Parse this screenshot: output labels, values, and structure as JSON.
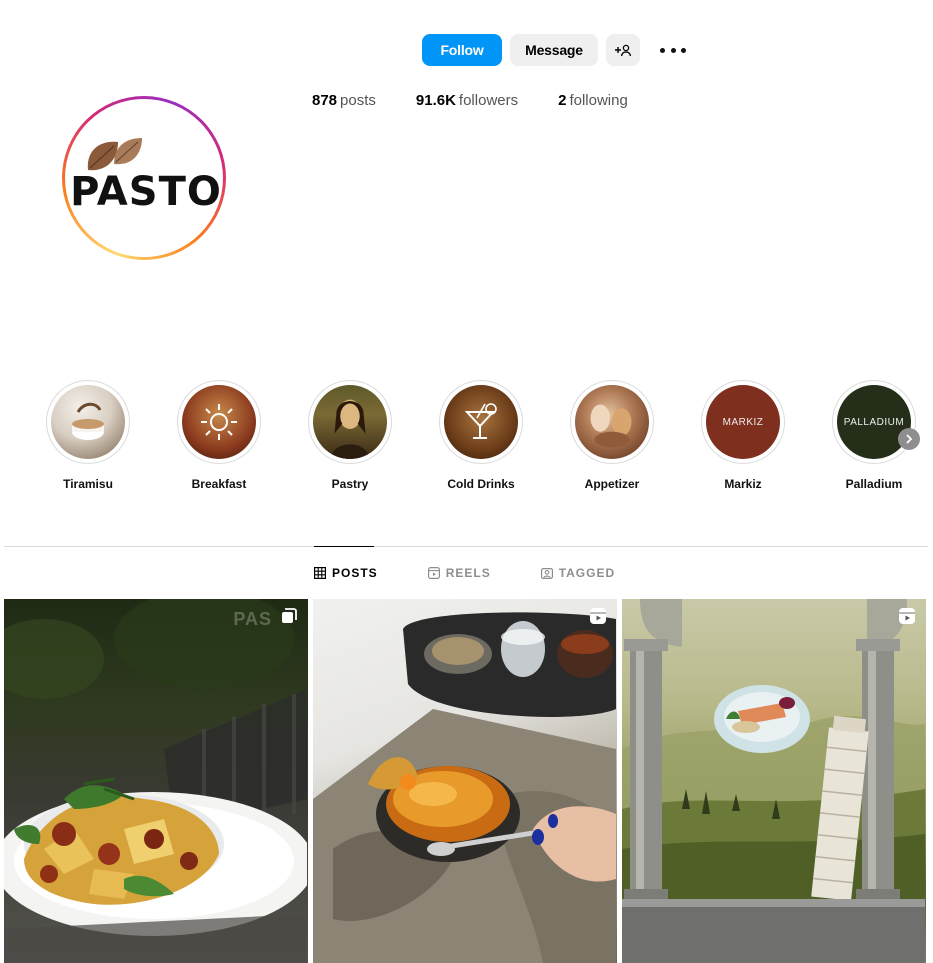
{
  "profile": {
    "logo_text": "PASTO",
    "actions": {
      "follow_label": "Follow",
      "message_label": "Message",
      "add_user_label": "+੭"
    },
    "stats": [
      {
        "value": "878",
        "label": "posts"
      },
      {
        "value": "91.6K",
        "label": "followers"
      },
      {
        "value": "2",
        "label": "following"
      }
    ]
  },
  "highlights": [
    {
      "label": "Tiramisu"
    },
    {
      "label": "Breakfast"
    },
    {
      "label": "Pastry"
    },
    {
      "label": "Cold Drinks"
    },
    {
      "label": "Appetizer"
    },
    {
      "label": "Markiz",
      "cover_text": "MARKIZ"
    },
    {
      "label": "Palladium",
      "cover_text": "PALLADIUM"
    }
  ],
  "tabs": [
    {
      "label": "POSTS",
      "icon": "grid-icon",
      "active": true
    },
    {
      "label": "REELS",
      "icon": "reels-icon",
      "active": false
    },
    {
      "label": "TAGGED",
      "icon": "tagged-icon",
      "active": false
    }
  ],
  "posts": [
    {
      "subject": "pasta plate",
      "type_icon": "carousel-icon",
      "watermark": "PAS"
    },
    {
      "subject": "creme brulee",
      "type_icon": "reel-icon"
    },
    {
      "subject": "leaning tower scene",
      "type_icon": "reel-icon"
    }
  ],
  "colors": {
    "accent": "#0095f6",
    "secondary_button": "#efefef",
    "muted_text": "#8e8e8e"
  }
}
